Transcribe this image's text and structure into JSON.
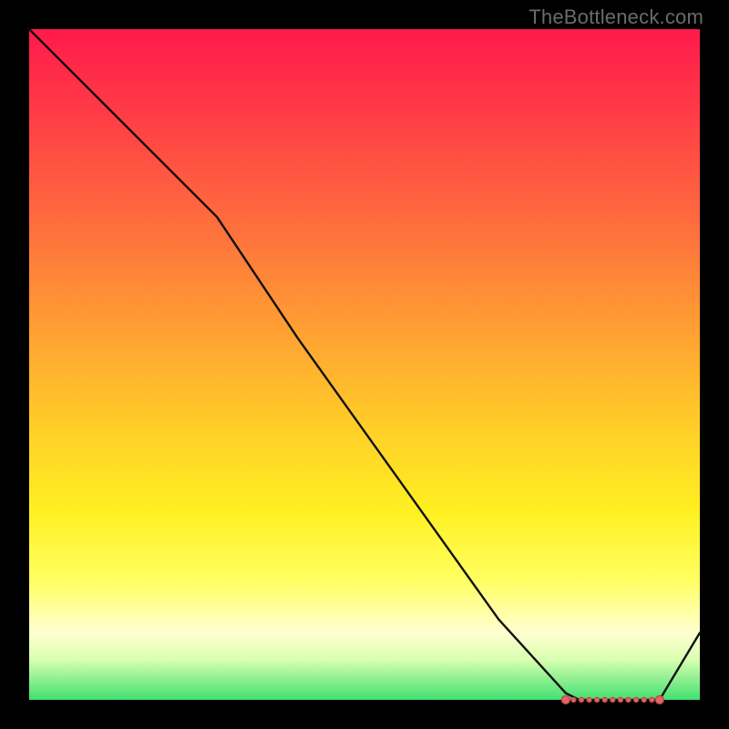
{
  "watermark": "TheBottleneck.com",
  "chart_data": {
    "type": "line",
    "title": "",
    "xlabel": "",
    "ylabel": "",
    "x": [
      0.0,
      0.1,
      0.2,
      0.28,
      0.4,
      0.55,
      0.7,
      0.8,
      0.82,
      0.84,
      0.86,
      0.88,
      0.9,
      0.92,
      0.94,
      1.0
    ],
    "y": [
      1.0,
      0.9,
      0.8,
      0.72,
      0.54,
      0.33,
      0.12,
      0.01,
      0.0,
      0.0,
      0.0,
      0.0,
      0.0,
      0.0,
      0.0,
      0.1
    ],
    "highlight_region_x": [
      0.8,
      0.94
    ],
    "xlim": [
      0,
      1
    ],
    "ylim": [
      0,
      1
    ]
  },
  "colors": {
    "line": "#111111",
    "marker": "#e06666",
    "bg_top": "#ff1a4b",
    "bg_bottom": "#40e070"
  }
}
